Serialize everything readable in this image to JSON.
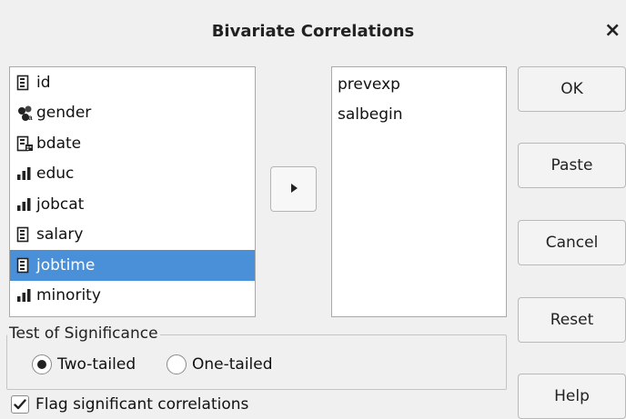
{
  "window": {
    "title": "Bivariate Correlations",
    "close_glyph": "×"
  },
  "source_variables": [
    {
      "label": "id",
      "icon": "scale-variable-icon"
    },
    {
      "label": "gender",
      "icon": "nominal-variable-icon"
    },
    {
      "label": "bdate",
      "icon": "date-variable-icon"
    },
    {
      "label": "educ",
      "icon": "ordinal-variable-icon"
    },
    {
      "label": "jobcat",
      "icon": "ordinal-variable-icon"
    },
    {
      "label": "salary",
      "icon": "scale-variable-icon"
    },
    {
      "label": "jobtime",
      "icon": "scale-variable-icon",
      "selected": true
    },
    {
      "label": "minority",
      "icon": "ordinal-variable-icon"
    }
  ],
  "target_variables": [
    "prevexp",
    "salbegin"
  ],
  "buttons": {
    "ok": "OK",
    "paste": "Paste",
    "cancel": "Cancel",
    "reset": "Reset",
    "help": "Help"
  },
  "significance": {
    "legend": "Test of Significance",
    "two_tailed": "Two-tailed",
    "one_tailed": "One-tailed",
    "selected": "two_tailed"
  },
  "flag": {
    "label": "Flag significant correlations",
    "checked": true
  },
  "colors": {
    "selection": "#4a90d9",
    "window_bg": "#f0f0f0"
  }
}
